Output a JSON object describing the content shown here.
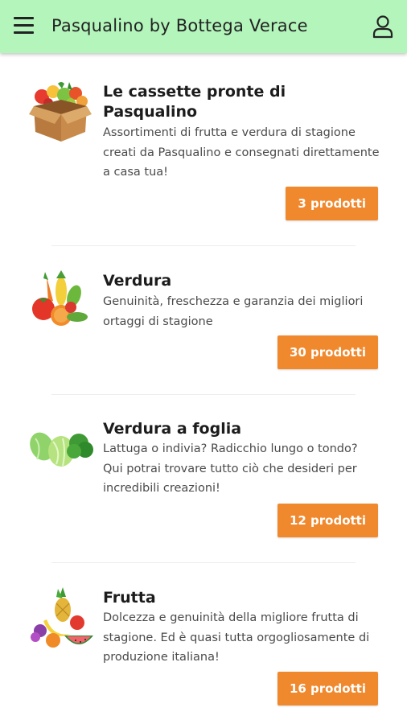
{
  "header": {
    "title": "Pasqualino by Bottega Verace",
    "menu_icon": "hamburger-menu-icon",
    "user_icon": "user-account-icon",
    "background_color": "#b3f5bb"
  },
  "categories": [
    {
      "title": "Le cassette pronte di Pasqualino",
      "description": "Assortimenti di frutta e verdura di stagione creati da Pasqualino e consegnati direttamente a casa tua!",
      "count_label": "3 prodotti",
      "icon": "fruit-box-icon"
    },
    {
      "title": "Verdura",
      "description": "Genuinità, freschezza e garanzia dei migliori ortaggi di stagione",
      "count_label": "30 prodotti",
      "icon": "vegetables-icon"
    },
    {
      "title": "Verdura a foglia",
      "description": "Lattuga o indivia? Radicchio lungo o tondo? Qui potrai trovare tutto ciò che desideri per incredibili creazioni!",
      "count_label": "12 prodotti",
      "icon": "leafy-greens-icon"
    },
    {
      "title": "Frutta",
      "description": "Dolcezza e genuinità della migliore frutta di stagione. Ed è quasi tutta orgogliosamente di produzione italiana!",
      "count_label": "16 prodotti",
      "icon": "fruits-icon"
    }
  ],
  "colors": {
    "accent": "#f0892e",
    "text": "#1c1c1c",
    "secondary_text": "#4a4a4a"
  }
}
